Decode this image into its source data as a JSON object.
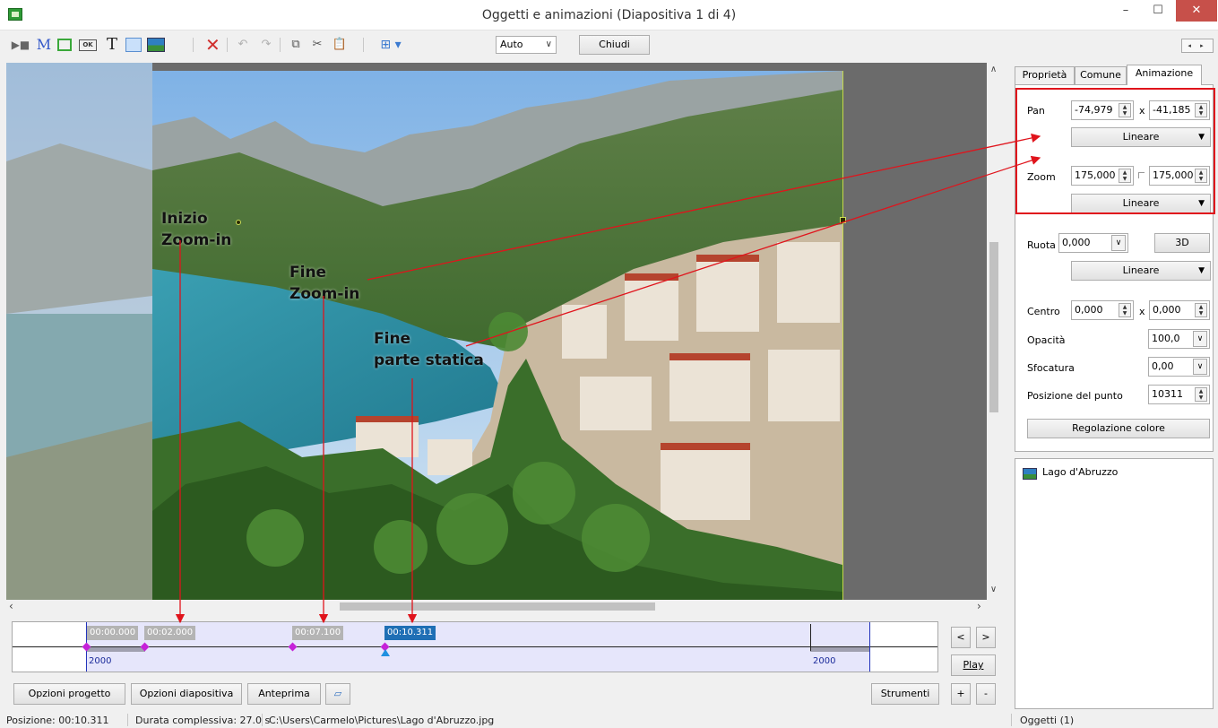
{
  "window": {
    "title": "Oggetti e animazioni  (Diapositiva 1 di 4)",
    "minimize": "–",
    "maximize": "☐",
    "close": "✕"
  },
  "toolbar": {
    "camera_icon": "▶■",
    "mask_icon": "M",
    "button_icon": "OK",
    "text_icon": "T",
    "delete_icon": "✕",
    "undo_icon": "↶",
    "redo_icon": "↷",
    "copy_icon": "⧉",
    "cut_icon": "✂",
    "paste_icon": "📋",
    "grid_icon": "⊞ ▾",
    "zoom_value": "Auto",
    "close_label": "Chiudi",
    "nav_arrows": "◂ ▸"
  },
  "annotations": {
    "start_line1": "Inizio",
    "start_line2": "Zoom-in",
    "end_line1": "Fine",
    "end_line2": "Zoom-in",
    "static_line1": "Fine",
    "static_line2": "parte statica"
  },
  "timeline": {
    "markers": [
      "00:00.000",
      "00:02.000",
      "00:07.100",
      "00:10.311"
    ],
    "duration_left": "2000",
    "duration_right": "2000"
  },
  "controls": {
    "prev": "<",
    "next": ">",
    "play": "Play",
    "add": "+",
    "remove": "-",
    "project_options": "Opzioni progetto",
    "slide_options": "Opzioni diapositiva",
    "preview": "Anteprima",
    "fullscreen_icon": "▱",
    "tools": "Strumenti"
  },
  "tabs": [
    "Proprietà",
    "Comune",
    "Animazione"
  ],
  "animation": {
    "pan_label": "Pan",
    "pan_x": "-74,979",
    "pan_sep": "x",
    "pan_y": "-41,185",
    "pan_interp": "Lineare",
    "zoom_label": "Zoom",
    "zoom_x": "175,000",
    "zoom_y": "175,000",
    "zoom_interp": "Lineare",
    "rotate_label": "Ruota",
    "rotate_value": "0,000",
    "btn_3d": "3D",
    "rotate_interp": "Lineare",
    "center_label": "Centro",
    "center_x": "0,000",
    "center_sep": "x",
    "center_y": "0,000",
    "opacity_label": "Opacità",
    "opacity_value": "100,0",
    "blur_label": "Sfocatura",
    "blur_value": "0,00",
    "point_label": "Posizione del punto",
    "point_value": "10311",
    "color_adjust": "Regolazione colore"
  },
  "objects_list": {
    "item": "Lago d'Abruzzo"
  },
  "status": {
    "position": "Posizione:  00:10.311",
    "duration": "Durata complessiva:  27.0 s",
    "path": "C:\\Users\\Carmelo\\Pictures\\Lago d'Abruzzo.jpg",
    "objects": "Oggetti (1)"
  },
  "colors": {
    "highlight": "#e0141c",
    "keyframe": "#c522d8",
    "cursor": "#1e90e0",
    "accent_blue": "#1f6fb5"
  }
}
